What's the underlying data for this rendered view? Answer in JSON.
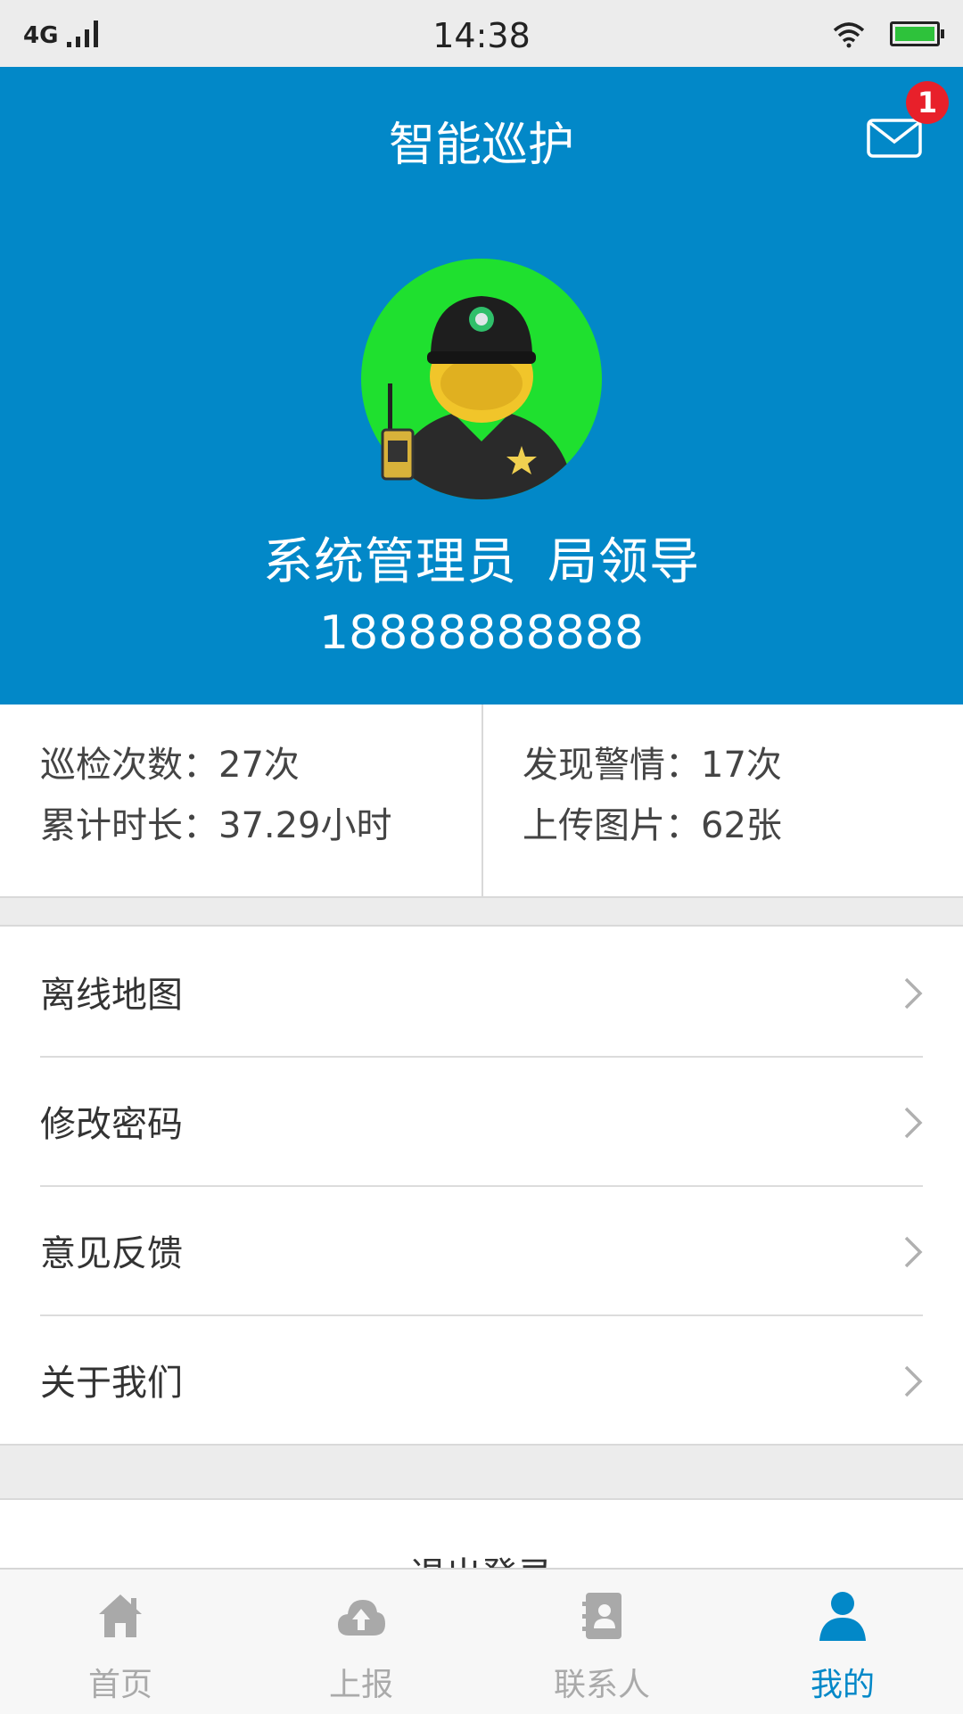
{
  "status_bar": {
    "network": "4G",
    "time": "14:38"
  },
  "header": {
    "title": "智能巡护",
    "unread_count": "1",
    "user_name": "系统管理员",
    "user_role": "局领导",
    "phone": "18888888888"
  },
  "stats": {
    "patrol_count": "巡检次数：27次",
    "total_duration": "累计时长：37.29小时",
    "alerts_found": "发现警情：17次",
    "images_uploaded": "上传图片：62张"
  },
  "menu": {
    "items": [
      {
        "label": "离线地图"
      },
      {
        "label": "修改密码"
      },
      {
        "label": "意见反馈"
      },
      {
        "label": "关于我们"
      }
    ]
  },
  "logout": {
    "label": "退出登录"
  },
  "tabbar": {
    "tabs": [
      {
        "label": "首页",
        "icon": "home-icon"
      },
      {
        "label": "上报",
        "icon": "cloud-upload-icon"
      },
      {
        "label": "联系人",
        "icon": "contacts-icon"
      },
      {
        "label": "我的",
        "icon": "user-icon"
      }
    ],
    "active_index": 3
  },
  "colors": {
    "primary": "#0288c8",
    "badge": "#e8202a",
    "inactive_tab": "#aaaaaa"
  }
}
